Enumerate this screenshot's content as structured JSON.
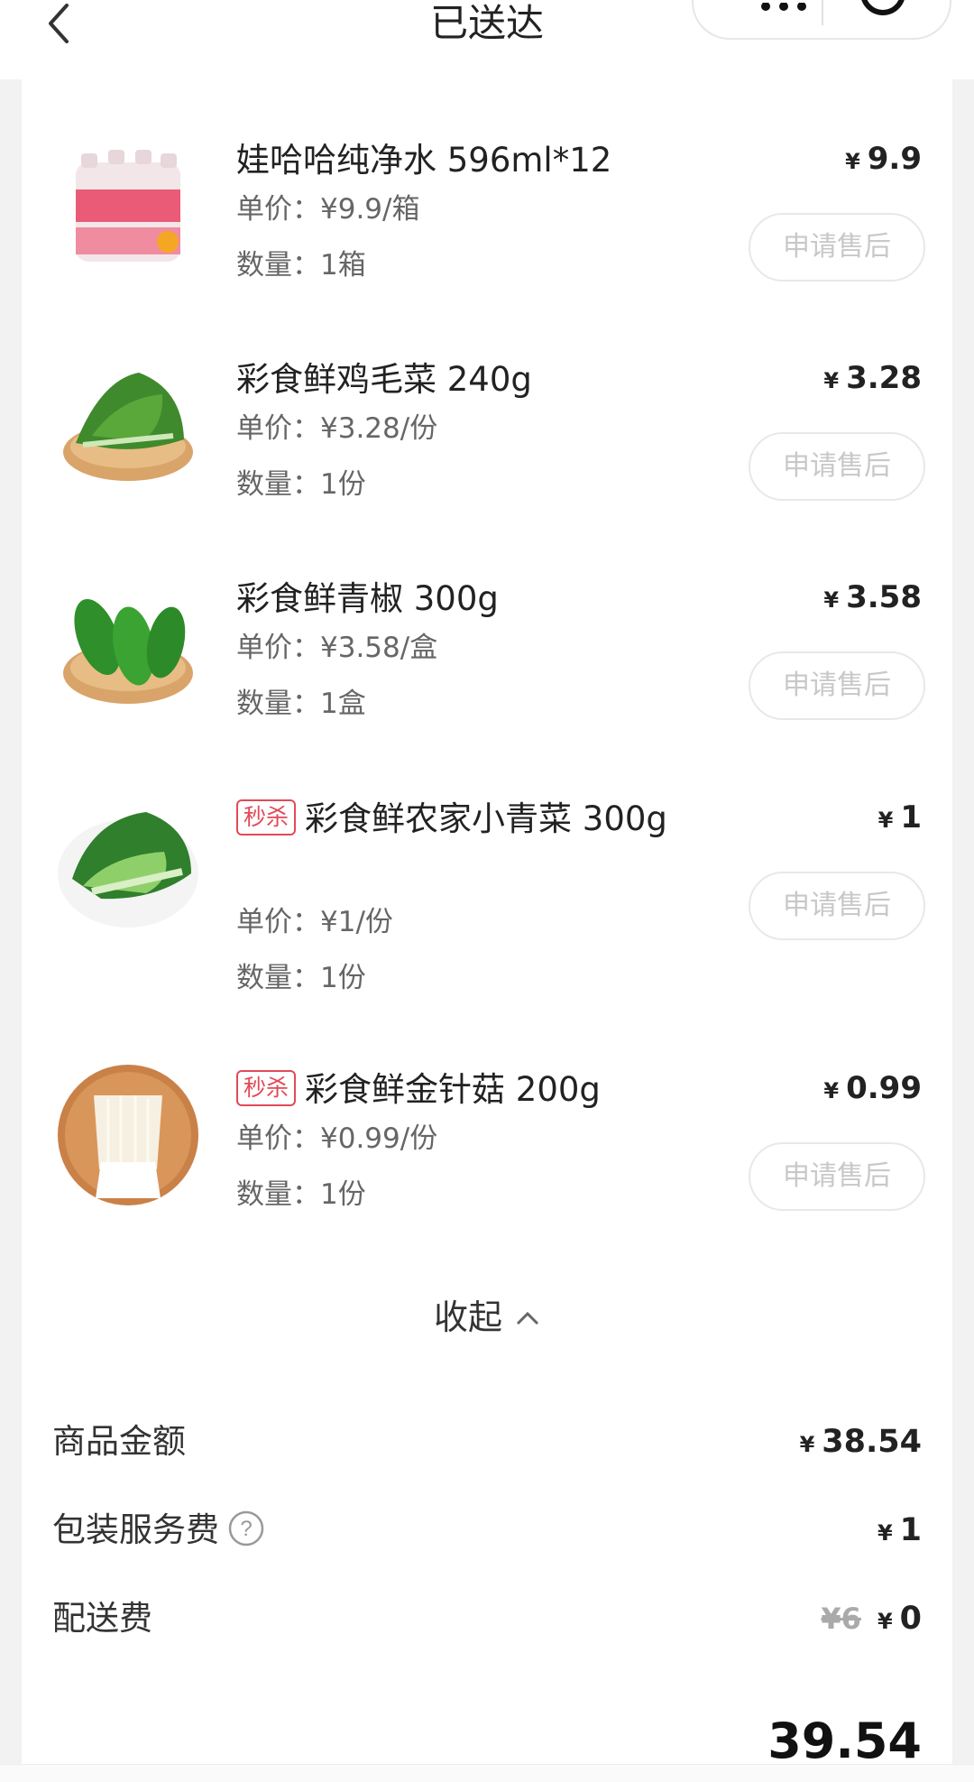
{
  "header": {
    "title": "已送达"
  },
  "items": [
    {
      "name": "娃哈哈纯净水 596ml*12",
      "tag": "",
      "unit_price": "单价：¥9.9/箱",
      "quantity": "数量：1箱",
      "price": "9.9",
      "after_sale": "申请售后",
      "image": "water-bottles"
    },
    {
      "name": "彩食鲜鸡毛菜 240g",
      "tag": "",
      "unit_price": "单价：¥3.28/份",
      "quantity": "数量：1份",
      "price": "3.28",
      "after_sale": "申请售后",
      "image": "leafy-greens"
    },
    {
      "name": "彩食鲜青椒 300g",
      "tag": "",
      "unit_price": "单价：¥3.58/盒",
      "quantity": "数量：1盒",
      "price": "3.58",
      "after_sale": "申请售后",
      "image": "green-peppers"
    },
    {
      "name": "彩食鲜农家小青菜 300g",
      "tag": "秒杀",
      "unit_price": "单价：¥1/份",
      "quantity": "数量：1份",
      "price": "1",
      "after_sale": "申请售后",
      "image": "bok-choy"
    },
    {
      "name": "彩食鲜金针菇 200g",
      "tag": "秒杀",
      "unit_price": "单价：¥0.99/份",
      "quantity": "数量：1份",
      "price": "0.99",
      "after_sale": "申请售后",
      "image": "enoki-mushroom"
    }
  ],
  "currency": "¥",
  "collapse_label": "收起",
  "summary": {
    "goods_label": "商品金额",
    "goods_value": "38.54",
    "packing_label": "包装服务费",
    "packing_value": "1",
    "delivery_label": "配送费",
    "delivery_original": "¥6",
    "delivery_value": "0"
  },
  "total_partial": "39.54"
}
